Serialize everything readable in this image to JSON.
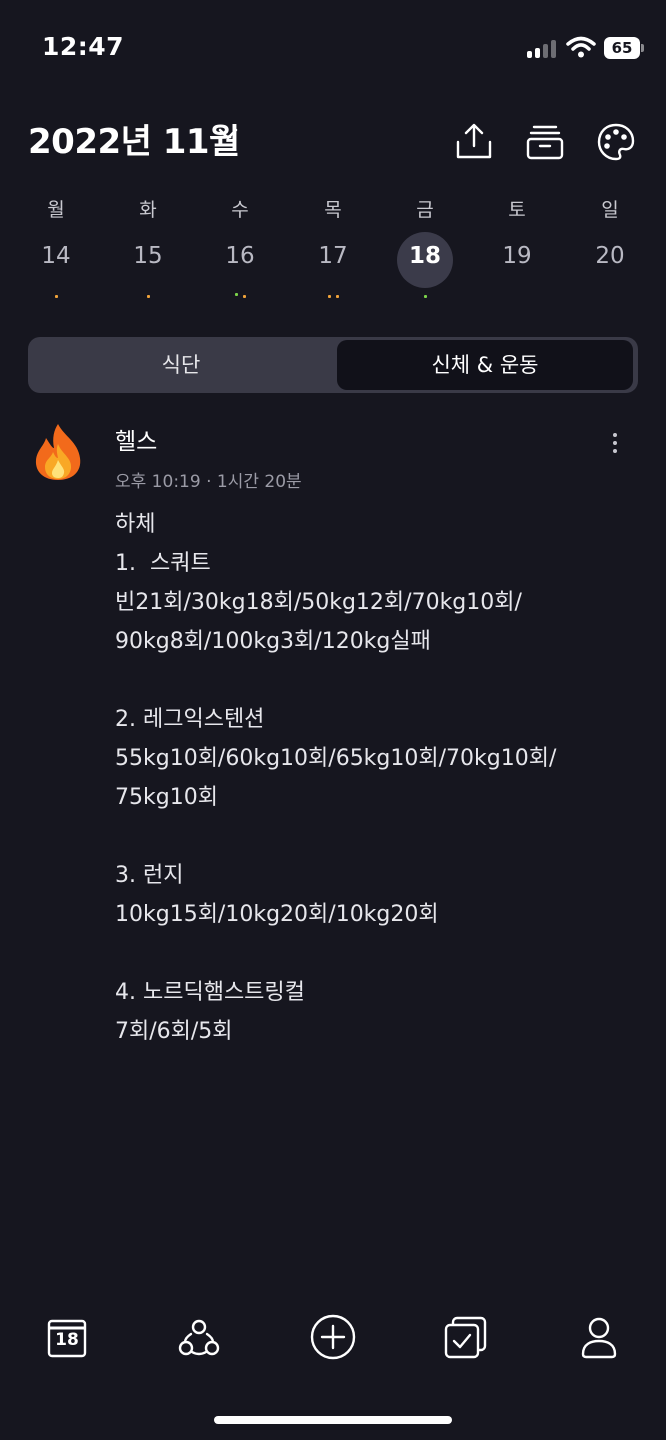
{
  "status_bar": {
    "time": "12:47",
    "battery": "65"
  },
  "header": {
    "month_title": "2022년 11월",
    "icons": [
      "share-upload-icon",
      "archive-box-icon",
      "palette-icon"
    ]
  },
  "week": {
    "days": [
      {
        "weekday": "월",
        "date": "14",
        "dots": [
          "#f0a33a"
        ]
      },
      {
        "weekday": "화",
        "date": "15",
        "dots": [
          "#f0a33a"
        ]
      },
      {
        "weekday": "수",
        "date": "16",
        "dots": [
          "#7bd34a",
          "#f0a33a"
        ]
      },
      {
        "weekday": "목",
        "date": "17",
        "dots": [
          "#f0a33a",
          "#f0a33a"
        ]
      },
      {
        "weekday": "금",
        "date": "18",
        "dots": [
          "#7bd34a"
        ],
        "selected": true
      },
      {
        "weekday": "토",
        "date": "19",
        "dots": []
      },
      {
        "weekday": "일",
        "date": "20",
        "dots": []
      }
    ]
  },
  "tabs": {
    "diet": "식단",
    "body_exercise": "신체 & 운동",
    "active": "body_exercise"
  },
  "entry": {
    "icon": "fire-icon",
    "title": "헬스",
    "meta": "오후 10:19 · 1시간 20분",
    "body": "하체\n1.  스쿼트\n빈21회/30kg18회/50kg12회/70kg10회/\n90kg8회/100kg3회/120kg실패\n\n2. 레그익스텐션\n55kg10회/60kg10회/65kg10회/70kg10회/\n75kg10회\n\n3. 런지\n10kg15회/10kg20회/10kg20회\n\n4. 노르딕햄스트링컬\n7회/6회/5회"
  },
  "bottom_nav": {
    "calendar_date": "18",
    "items": [
      "calendar-icon",
      "community-icon",
      "add-icon",
      "checklist-icon",
      "profile-icon"
    ]
  },
  "colors": {
    "background": "#16161f",
    "accent_orange": "#f0a33a",
    "accent_green": "#7bd34a"
  }
}
